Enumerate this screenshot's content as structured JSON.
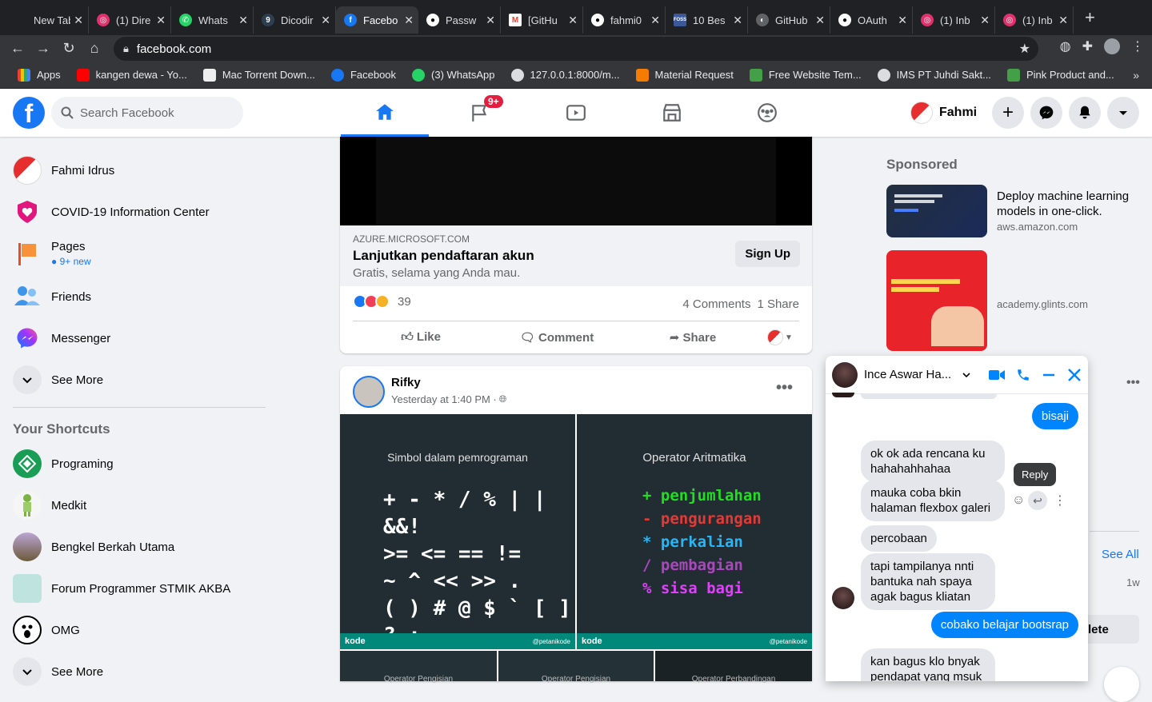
{
  "browser": {
    "tabs": [
      {
        "title": "New Tab",
        "icon": "chrome-icon",
        "color": "#5f6368"
      },
      {
        "title": "(1) Dire",
        "icon": "instagram-icon",
        "color": "#e1306c"
      },
      {
        "title": "Whats",
        "icon": "whatsapp-icon",
        "color": "#25d366"
      },
      {
        "title": "Dicodir",
        "icon": "dicoding-icon",
        "color": "#2d3e50"
      },
      {
        "title": "Facebo",
        "icon": "facebook-icon",
        "color": "#1877f2",
        "active": true
      },
      {
        "title": "Passw",
        "icon": "github-icon",
        "color": "#24292e"
      },
      {
        "title": "[GitHu",
        "icon": "gmail-icon",
        "color": "#ea4335"
      },
      {
        "title": "fahmi0",
        "icon": "github-icon",
        "color": "#24292e"
      },
      {
        "title": "10 Bes",
        "icon": "foss-icon",
        "color": "#3b5998"
      },
      {
        "title": "GitHub",
        "icon": "globe-icon",
        "color": "#5f6368"
      },
      {
        "title": "OAuth",
        "icon": "github-icon",
        "color": "#24292e"
      },
      {
        "title": "(1) Inb",
        "icon": "instagram-icon",
        "color": "#e1306c"
      },
      {
        "title": "(1) Inb",
        "icon": "instagram-icon",
        "color": "#e1306c"
      }
    ],
    "url": "facebook.com",
    "bookmarks": [
      {
        "label": "Apps",
        "color": "#ea4335"
      },
      {
        "label": "kangen dewa - Yo...",
        "color": "#ff0000"
      },
      {
        "label": "Mac Torrent Down...",
        "color": "#9e9e9e"
      },
      {
        "label": "Facebook",
        "color": "#1877f2"
      },
      {
        "label": "(3) WhatsApp",
        "color": "#25d366"
      },
      {
        "label": "127.0.0.1:8000/m...",
        "color": "#dadce0"
      },
      {
        "label": "Material Request",
        "color": "#f57c00"
      },
      {
        "label": "Free Website Tem...",
        "color": "#43a047"
      },
      {
        "label": "IMS PT Juhdi Sakt...",
        "color": "#dadce0"
      },
      {
        "label": "Pink Product and...",
        "color": "#43a047"
      }
    ]
  },
  "fb": {
    "search_placeholder": "Search Facebook",
    "nav_badge": "9+",
    "profile_name": "Fahmi",
    "accent": "#1877f2"
  },
  "sidebar": {
    "items": [
      {
        "label": "Fahmi Idrus"
      },
      {
        "label": "COVID-19 Information Center"
      },
      {
        "label": "Pages",
        "sub": "9+ new"
      },
      {
        "label": "Friends"
      },
      {
        "label": "Messenger"
      },
      {
        "label": "See More"
      }
    ],
    "shortcuts_title": "Your Shortcuts",
    "shortcuts": [
      {
        "label": "Programing"
      },
      {
        "label": "Medkit"
      },
      {
        "label": "Bengkel Berkah Utama"
      },
      {
        "label": "Forum Programmer STMIK AKBA"
      },
      {
        "label": "OMG"
      },
      {
        "label": "See More"
      }
    ]
  },
  "ad_post": {
    "domain": "AZURE.MICROSOFT.COM",
    "headline": "Lanjutkan pendaftaran akun",
    "desc": "Gratis, selama yang Anda mau.",
    "cta": "Sign Up",
    "reactions": "39",
    "comments": "4 Comments",
    "shares": "1 Share",
    "like": "Like",
    "comment": "Comment",
    "share": "Share"
  },
  "post2": {
    "author": "Rifky",
    "time": "Yesterday at 1:40 PM · ",
    "img1_title": "Simbol dalam pemrograman",
    "img1_lines": [
      "+ - * / % | | &&!",
      ">= <= == !=",
      "~ ^ << >> .",
      "( ) # @ $ ` [ ] ? :"
    ],
    "img2_title": "Operator Aritmatika",
    "img2_lines": [
      {
        "sym": "+",
        "text": "penjumlahan",
        "color": "#22dd22"
      },
      {
        "sym": "-",
        "text": "pengurangan",
        "color": "#e53935"
      },
      {
        "sym": "*",
        "text": "perkalian",
        "color": "#29b6f6"
      },
      {
        "sym": "/",
        "text": "pembagian",
        "color": "#ab47bc"
      },
      {
        "sym": "%",
        "text": "sisa bagi",
        "color": "#e040fb"
      }
    ],
    "brand": "kode",
    "handle": "@petanikode",
    "thumb_labels": [
      "Operator Pengisian",
      "Operator Pengisian",
      "Operator Perbandingan"
    ]
  },
  "right": {
    "sponsored": "Sponsored",
    "ads": [
      {
        "title": "Deploy machine learning models in one-click.",
        "site": "aws.amazon.com"
      },
      {
        "title": "",
        "site": "academy.glints.com"
      }
    ],
    "see_all": "See All",
    "time": "1w",
    "delete": "lete"
  },
  "chat": {
    "name": "Ince Aswar Ha...",
    "tooltip": "Reply",
    "messages": [
      {
        "dir": "out",
        "text": "bisaji"
      },
      {
        "dir": "in",
        "text": "ok ok ada rencana ku hahahahhahaa"
      },
      {
        "dir": "in",
        "text": "mauka coba bkin halaman flexbox galeri"
      },
      {
        "dir": "in",
        "text": "percobaan"
      },
      {
        "dir": "in",
        "text": "tapi tampilanya nnti bantuka nah spaya agak bagus kliatan"
      },
      {
        "dir": "out",
        "text": "cobako belajar bootsrap"
      },
      {
        "dir": "in",
        "text": "kan bagus klo bnyak pendapat yang msuk"
      }
    ]
  }
}
